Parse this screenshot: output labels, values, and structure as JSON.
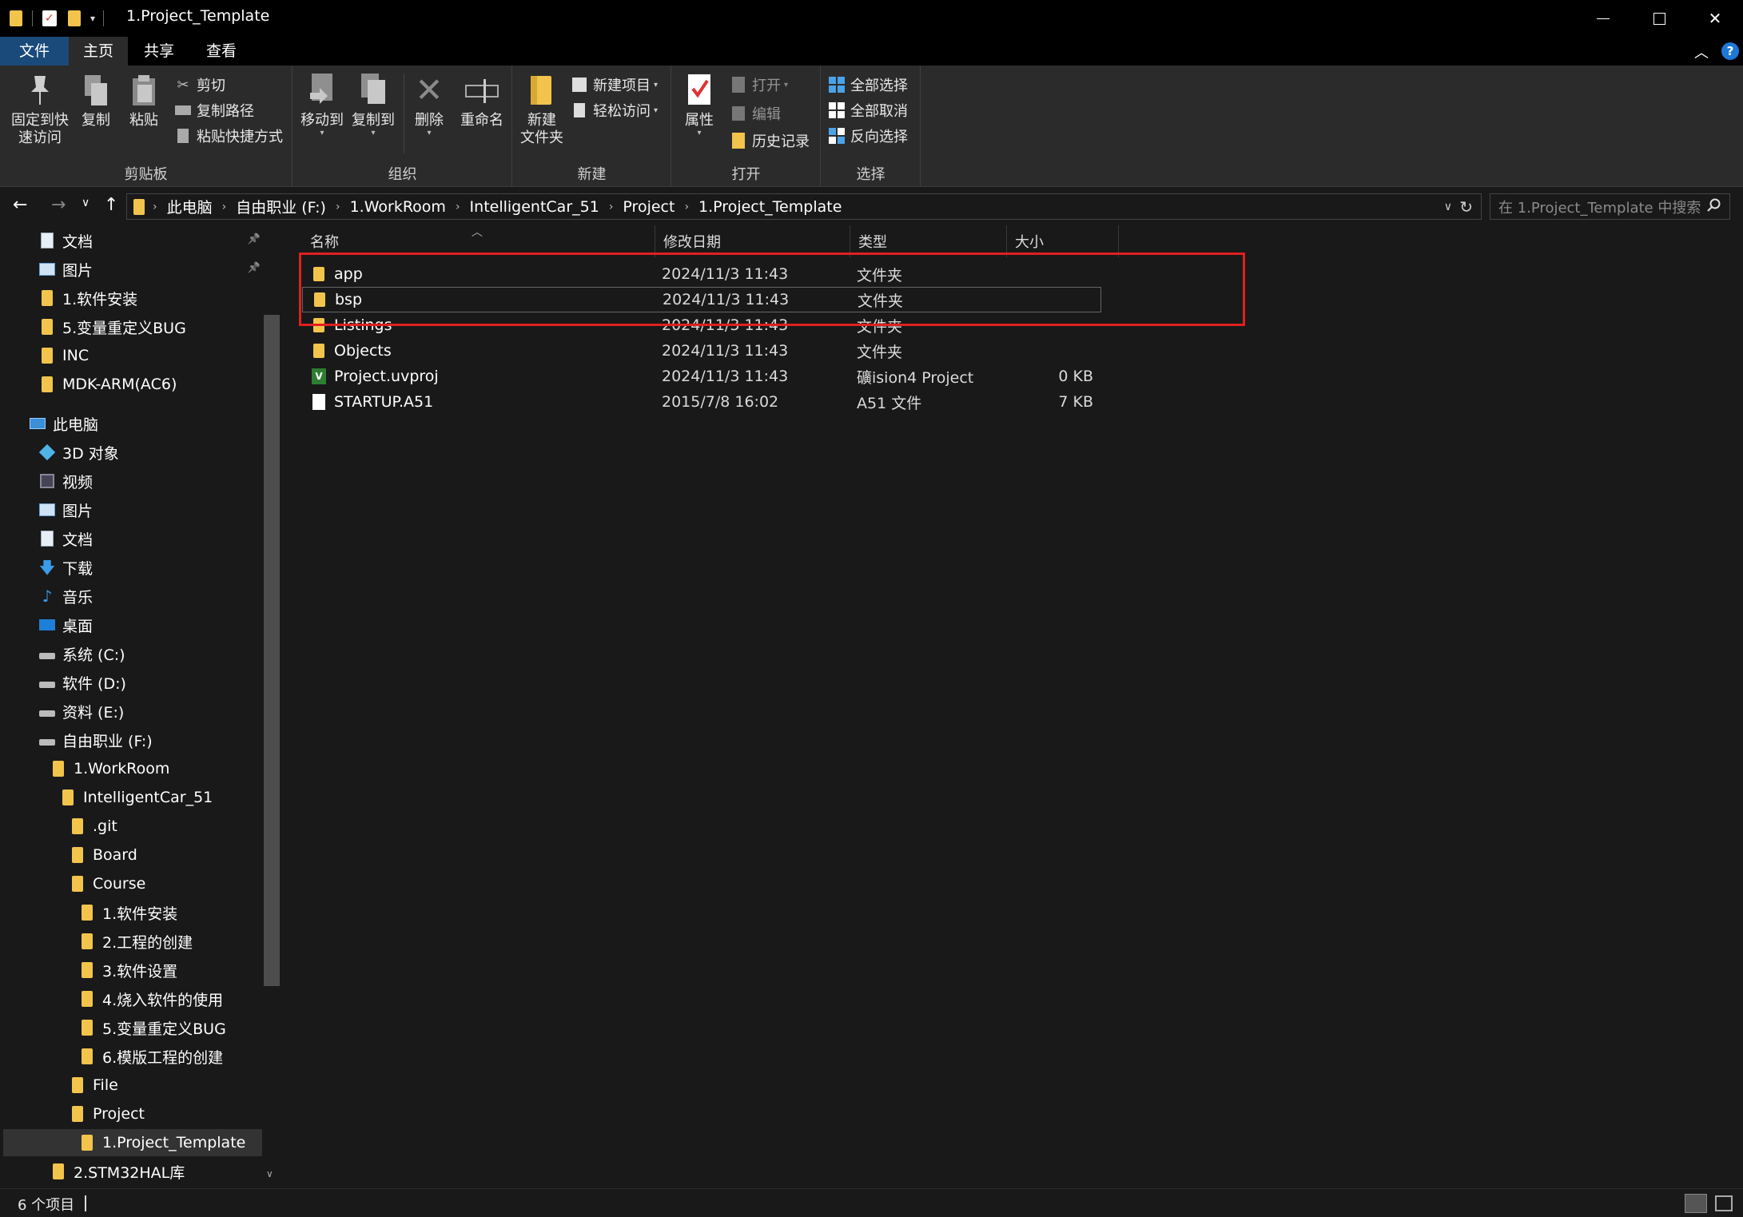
{
  "window": {
    "title": "1.Project_Template",
    "controls": {
      "minimize": "—",
      "maximize": "☐",
      "close": "✕"
    }
  },
  "ribbon_tabs": [
    "文件",
    "主页",
    "共享",
    "查看"
  ],
  "ribbon": {
    "clipboard": {
      "label": "剪贴板",
      "pin": "固定到快\n速访问",
      "copy": "复制",
      "paste": "粘贴",
      "cut": "剪切",
      "copy_path": "复制路径",
      "paste_shortcut": "粘贴快捷方式"
    },
    "organize": {
      "label": "组织",
      "move_to": "移动到",
      "copy_to": "复制到",
      "delete": "删除",
      "rename": "重命名"
    },
    "new": {
      "label": "新建",
      "new_folder": "新建\n文件夹",
      "new_item": "新建项目",
      "easy_access": "轻松访问"
    },
    "open": {
      "label": "打开",
      "properties": "属性",
      "open": "打开",
      "edit": "编辑",
      "history": "历史记录"
    },
    "select": {
      "label": "选择",
      "select_all": "全部选择",
      "select_none": "全部取消",
      "invert": "反向选择"
    }
  },
  "address": {
    "crumbs": [
      "此电脑",
      "自由职业 (F:)",
      "1.WorkRoom",
      "IntelligentCar_51",
      "Project",
      "1.Project_Template"
    ],
    "search_placeholder": "在 1.Project_Template 中搜索"
  },
  "nav_pane": [
    {
      "label": "文档",
      "icon": "document-icon",
      "indent": 0,
      "pinned": true
    },
    {
      "label": "图片",
      "icon": "pictures-icon",
      "indent": 0,
      "pinned": true
    },
    {
      "label": "1.软件安装",
      "icon": "folder-icon",
      "indent": 0
    },
    {
      "label": "5.变量重定义BUG",
      "icon": "folder-icon",
      "indent": 0
    },
    {
      "label": "INC",
      "icon": "folder-icon",
      "indent": 0
    },
    {
      "label": "MDK-ARM(AC6)",
      "icon": "folder-icon",
      "indent": 0
    },
    {
      "label": "此电脑",
      "icon": "computer-icon",
      "indent": -1
    },
    {
      "label": "3D 对象",
      "icon": "3d-objects-icon",
      "indent": 0
    },
    {
      "label": "视频",
      "icon": "videos-icon",
      "indent": 0
    },
    {
      "label": "图片",
      "icon": "pictures-icon",
      "indent": 0
    },
    {
      "label": "文档",
      "icon": "document-icon",
      "indent": 0
    },
    {
      "label": "下载",
      "icon": "download-icon",
      "indent": 0
    },
    {
      "label": "音乐",
      "icon": "music-icon",
      "indent": 0
    },
    {
      "label": "桌面",
      "icon": "desktop-icon",
      "indent": 0
    },
    {
      "label": "系统 (C:)",
      "icon": "drive-icon",
      "indent": 0
    },
    {
      "label": "软件 (D:)",
      "icon": "drive-icon",
      "indent": 0
    },
    {
      "label": "资料 (E:)",
      "icon": "drive-icon",
      "indent": 0
    },
    {
      "label": "自由职业 (F:)",
      "icon": "drive-icon",
      "indent": 0
    },
    {
      "label": "1.WorkRoom",
      "icon": "folder-icon",
      "indent": 1
    },
    {
      "label": "IntelligentCar_51",
      "icon": "folder-icon",
      "indent": 2
    },
    {
      "label": ".git",
      "icon": "folder-icon",
      "indent": 3
    },
    {
      "label": "Board",
      "icon": "folder-icon",
      "indent": 3
    },
    {
      "label": "Course",
      "icon": "folder-icon",
      "indent": 3
    },
    {
      "label": "1.软件安装",
      "icon": "folder-icon",
      "indent": 4
    },
    {
      "label": "2.工程的创建",
      "icon": "folder-icon",
      "indent": 4
    },
    {
      "label": "3.软件设置",
      "icon": "folder-icon",
      "indent": 4
    },
    {
      "label": "4.烧入软件的使用",
      "icon": "folder-icon",
      "indent": 4
    },
    {
      "label": "5.变量重定义BUG",
      "icon": "folder-icon",
      "indent": 4
    },
    {
      "label": "6.模版工程的创建",
      "icon": "folder-icon",
      "indent": 4
    },
    {
      "label": "File",
      "icon": "folder-icon",
      "indent": 3
    },
    {
      "label": "Project",
      "icon": "folder-icon",
      "indent": 3
    },
    {
      "label": "1.Project_Template",
      "icon": "folder-icon",
      "indent": 4,
      "selected": true
    },
    {
      "label": "2.STM32HAL库",
      "icon": "folder-icon",
      "indent": 1
    }
  ],
  "columns": {
    "name": "名称",
    "date": "修改日期",
    "type": "类型",
    "size": "大小"
  },
  "files": [
    {
      "name": "app",
      "date": "2024/11/3 11:43",
      "type": "文件夹",
      "size": "",
      "icon": "folder-icon"
    },
    {
      "name": "bsp",
      "date": "2024/11/3 11:43",
      "type": "文件夹",
      "size": "",
      "icon": "folder-icon",
      "focused": true
    },
    {
      "name": "Listings",
      "date": "2024/11/3 11:43",
      "type": "文件夹",
      "size": "",
      "icon": "folder-icon"
    },
    {
      "name": "Objects",
      "date": "2024/11/3 11:43",
      "type": "文件夹",
      "size": "",
      "icon": "folder-icon"
    },
    {
      "name": "Project.uvproj",
      "date": "2024/11/3 11:43",
      "type": "礦ision4 Project",
      "size": "0 KB",
      "icon": "uvision-project-icon"
    },
    {
      "name": "STARTUP.A51",
      "date": "2015/7/8 16:02",
      "type": "A51 文件",
      "size": "7 KB",
      "icon": "file-icon"
    }
  ],
  "status": {
    "count": "6 个项目"
  },
  "colors": {
    "folder": "#f2c44c",
    "accent": "#1a4a7a",
    "highlight": "#e02020"
  }
}
